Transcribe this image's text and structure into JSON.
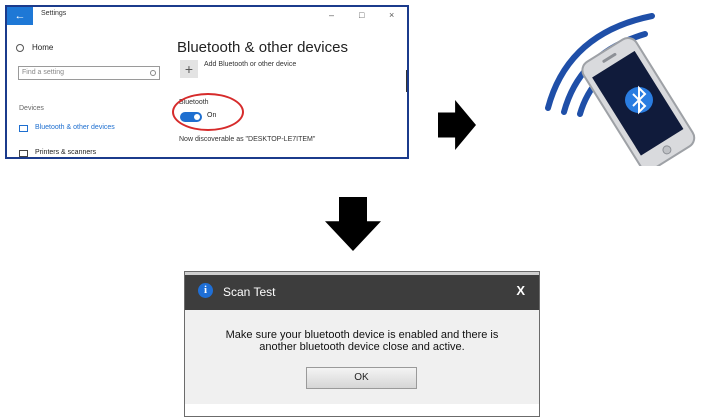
{
  "settings_window": {
    "back_glyph": "←",
    "title": "Settings",
    "minimize_glyph": "–",
    "maximize_glyph": "□",
    "close_glyph": "×",
    "home_label": "Home",
    "search_placeholder": "Find a setting",
    "devices_heading": "Devices",
    "nav_items": [
      {
        "label": "Bluetooth & other devices",
        "icon": "bluetooth-devices-icon"
      },
      {
        "label": "Printers & scanners",
        "icon": "printer-icon"
      }
    ],
    "panel_title": "Bluetooth & other devices",
    "add_device_label": "Add Bluetooth or other device",
    "add_glyph": "+",
    "bluetooth_label": "Bluetooth",
    "toggle_state": "On",
    "discoverable_text": "Now discoverable as \"DESKTOP-LE7ITEM\""
  },
  "dialog": {
    "info_glyph": "i",
    "title": "Scan Test",
    "close_glyph": "X",
    "message_line1": "Make sure your bluetooth device is enabled and there is",
    "message_line2": "another bluetooth device close and active.",
    "ok_label": "OK"
  },
  "colors": {
    "accent_blue": "#1e6fd0",
    "highlight_red": "#d62b2b",
    "dialog_titlebar": "#3d3d3d",
    "window_border": "#1b3b8c"
  },
  "icons": [
    "home-icon",
    "search-icon",
    "bluetooth-devices-icon",
    "printer-icon",
    "info-icon",
    "bluetooth-icon",
    "phone-icon"
  ]
}
